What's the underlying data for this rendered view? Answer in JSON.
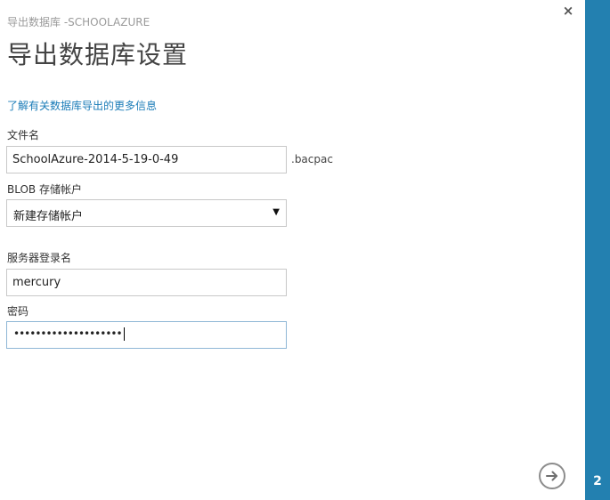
{
  "header": {
    "subtitle": "导出数据库 -SCHOOLAZURE",
    "title": "导出数据库设置",
    "close_symbol": "×"
  },
  "info_link": {
    "label": "了解有关数据库导出的更多信息"
  },
  "form": {
    "file_name": {
      "label": "文件名",
      "value": "SchoolAzure-2014-5-19-0-49",
      "suffix": ".bacpac"
    },
    "storage_account": {
      "label": "BLOB 存储帐户",
      "selected": "新建存储帐户"
    },
    "server_login": {
      "label": "服务器登录名",
      "value": "mercury"
    },
    "password": {
      "label": "密码",
      "masked": "••••••••••••••••••••"
    }
  },
  "footer": {
    "next_icon": "arrow-right-icon"
  },
  "wizard": {
    "step": "2",
    "accent_color": "#2380b0"
  }
}
